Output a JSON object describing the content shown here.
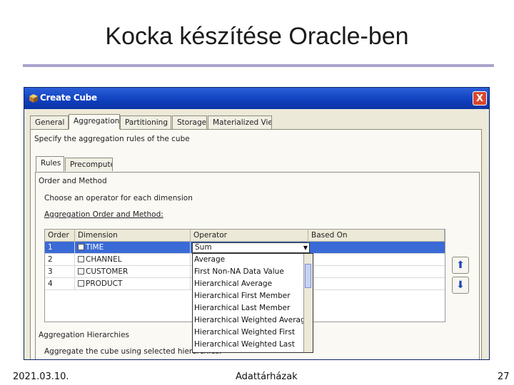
{
  "slide": {
    "title": "Kocka készítése Oracle-ben",
    "footer_date": "2021.03.10.",
    "footer_center": "Adattárházak",
    "page_number": "27"
  },
  "window": {
    "title": "Create Cube",
    "close_symbol": "X",
    "tabs": [
      "General",
      "Aggregation",
      "Partitioning",
      "Storage",
      "Materialized Views"
    ],
    "active_tab": "Aggregation",
    "instruction": "Specify the aggregation rules of the cube",
    "subtabs": [
      "Rules",
      "Precompute"
    ],
    "active_subtab": "Rules",
    "section_label": "Order and Method",
    "choose_text": "Choose an operator for each dimension",
    "grid_label": "Aggregation Order and Method:",
    "grid": {
      "headers": [
        "Order",
        "Dimension",
        "Operator",
        "Based On"
      ],
      "rows": [
        {
          "order": "1",
          "dimension": "TIME",
          "operator": "Sum",
          "based_on": ""
        },
        {
          "order": "2",
          "dimension": "CHANNEL",
          "operator": "",
          "based_on": ""
        },
        {
          "order": "3",
          "dimension": "CUSTOMER",
          "operator": "",
          "based_on": ""
        },
        {
          "order": "4",
          "dimension": "PRODUCT",
          "operator": "",
          "based_on": ""
        }
      ],
      "selected_row": 0
    },
    "operator_options": [
      "Average",
      "First Non-NA Data Value",
      "Hierarchical Average",
      "Hierarchical First Member",
      "Hierarchical Last Member",
      "Hierarchical Weighted Average",
      "Hierarchical Weighted First",
      "Hierarchical Weighted Last"
    ],
    "hierarchies_label": "Aggregation Hierarchies",
    "hierarchies_text": "Aggregate the cube using selected hierarchies:"
  },
  "icons": {
    "app": "cube-app-icon",
    "move_up": "arrow-up-icon",
    "move_down": "arrow-down-icon"
  },
  "colors": {
    "titlebar": "#0f3fbd",
    "selection": "#3a6ad6",
    "title_rule": "#a8a4cc"
  }
}
